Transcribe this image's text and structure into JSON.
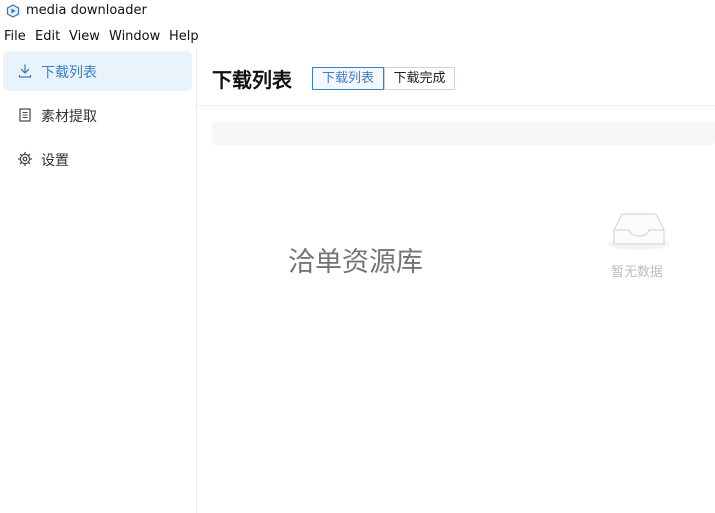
{
  "window": {
    "title": "media downloader"
  },
  "menu": [
    "File",
    "Edit",
    "View",
    "Window",
    "Help"
  ],
  "sidebar": {
    "items": [
      {
        "label": "下载列表",
        "icon": "download-icon",
        "active": true
      },
      {
        "label": "素材提取",
        "icon": "document-list-icon",
        "active": false
      },
      {
        "label": "设置",
        "icon": "gear-icon",
        "active": false
      }
    ]
  },
  "main": {
    "title": "下载列表",
    "tabs": [
      {
        "label": "下载列表",
        "active": true
      },
      {
        "label": "下载完成",
        "active": false
      }
    ],
    "watermark": "洽单资源库",
    "empty": {
      "text": "暂无数据",
      "icon": "empty-inbox-icon"
    }
  },
  "colors": {
    "accent": "#3a7fc4",
    "active_bg": "#e9f3fb",
    "muted": "#bdbdbd"
  }
}
